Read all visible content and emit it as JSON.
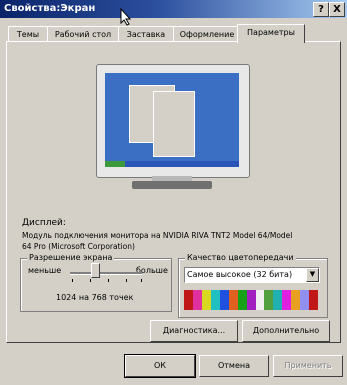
{
  "window": {
    "title": "Свойства:Экран",
    "help_label": "?",
    "close_label": "X"
  },
  "tabs": [
    {
      "label": "Темы"
    },
    {
      "label": "Рабочий стол"
    },
    {
      "label": "Заставка"
    },
    {
      "label": "Оформление"
    },
    {
      "label": "Параметры",
      "active": true
    }
  ],
  "display": {
    "label": "Дисплей:",
    "line1": "Модуль подключения монитора на NVIDIA RIVA TNT2 Model 64/Model",
    "line2": "64 Pro (Microsoft Corporation)"
  },
  "resolution": {
    "group_label": "Разрешение экрана",
    "less_label": "меньше",
    "more_label": "больше",
    "value_text": "1024 на 768 точек",
    "slider_position": 0.35
  },
  "color_quality": {
    "group_label": "Качество цветопередачи",
    "selected": "Самое высокое (32 бита)",
    "palette": [
      "#c01818",
      "#e030a0",
      "#d8d820",
      "#20c0c0",
      "#2050e0",
      "#e06020",
      "#18a018",
      "#a020c0",
      "#f0f0f0",
      "#50a040",
      "#20b0b0",
      "#e020e0",
      "#e8a020",
      "#9090f0",
      "#c01818"
    ]
  },
  "buttons": {
    "diagnostics": "Диагностика...",
    "advanced": "Дополнительно",
    "ok": "ОК",
    "cancel": "Отмена",
    "apply": "Применить"
  }
}
